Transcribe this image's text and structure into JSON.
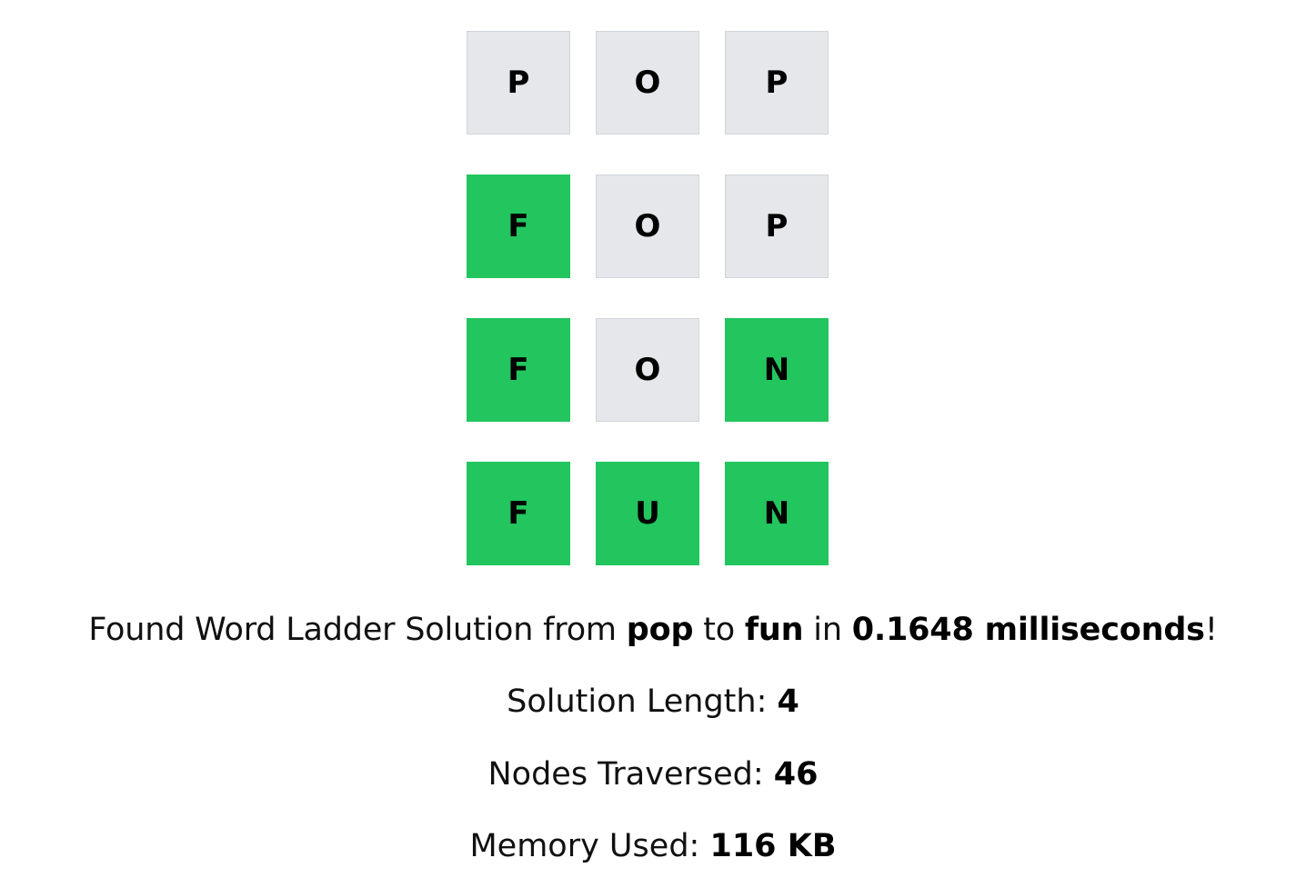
{
  "ladder": [
    [
      {
        "letter": "P",
        "changed": false
      },
      {
        "letter": "O",
        "changed": false
      },
      {
        "letter": "P",
        "changed": false
      }
    ],
    [
      {
        "letter": "F",
        "changed": true
      },
      {
        "letter": "O",
        "changed": false
      },
      {
        "letter": "P",
        "changed": false
      }
    ],
    [
      {
        "letter": "F",
        "changed": true
      },
      {
        "letter": "O",
        "changed": false
      },
      {
        "letter": "N",
        "changed": true
      }
    ],
    [
      {
        "letter": "F",
        "changed": true
      },
      {
        "letter": "U",
        "changed": true
      },
      {
        "letter": "N",
        "changed": true
      }
    ]
  ],
  "colors": {
    "changed_tile": "#22c55e",
    "unchanged_tile": "#e5e7eb"
  },
  "result": {
    "prefix": "Found Word Ladder Solution from ",
    "start_word": "pop",
    "to_text": " to ",
    "end_word": "fun",
    "in_text": " in ",
    "time": "0.1648 milliseconds",
    "suffix": "!"
  },
  "stats": {
    "length_label": "Solution Length: ",
    "length_value": "4",
    "nodes_label": "Nodes Traversed: ",
    "nodes_value": "46",
    "memory_label": "Memory Used: ",
    "memory_value": "116 KB"
  }
}
